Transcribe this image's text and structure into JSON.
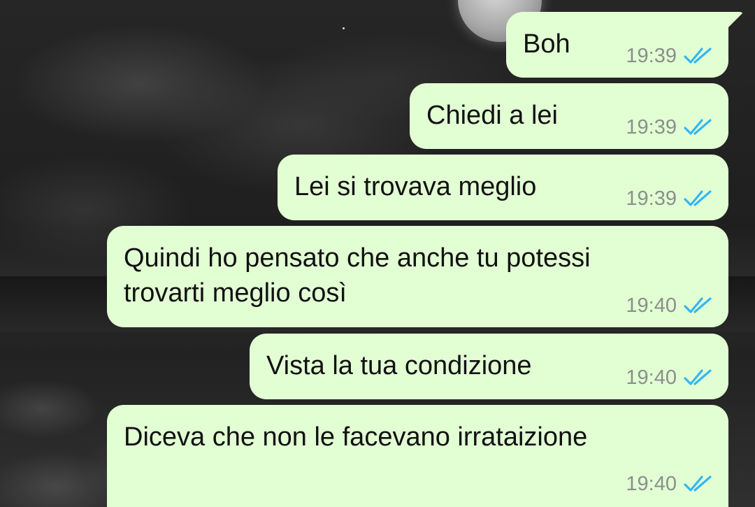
{
  "colors": {
    "bubble_background": "#e2ffd4",
    "time_text": "#8a8f8a",
    "read_ticks": "#34b7f1"
  },
  "messages": [
    {
      "text": "Boh",
      "time": "19:39",
      "status_icon": "double-check-read-icon"
    },
    {
      "text": "Chiedi a lei",
      "time": "19:39",
      "status_icon": "double-check-read-icon"
    },
    {
      "text": "Lei si trovava meglio",
      "time": "19:39",
      "status_icon": "double-check-read-icon"
    },
    {
      "text_lines": [
        "Quindi ho pensato che anche tu potessi",
        "trovarti meglio così"
      ],
      "time": "19:40",
      "status_icon": "double-check-read-icon"
    },
    {
      "text": "Vista la tua condizione",
      "time": "19:40",
      "status_icon": "double-check-read-icon"
    },
    {
      "text": "Diceva che non le facevano irrataizione",
      "time": "19:40",
      "status_icon": "double-check-read-icon"
    }
  ]
}
